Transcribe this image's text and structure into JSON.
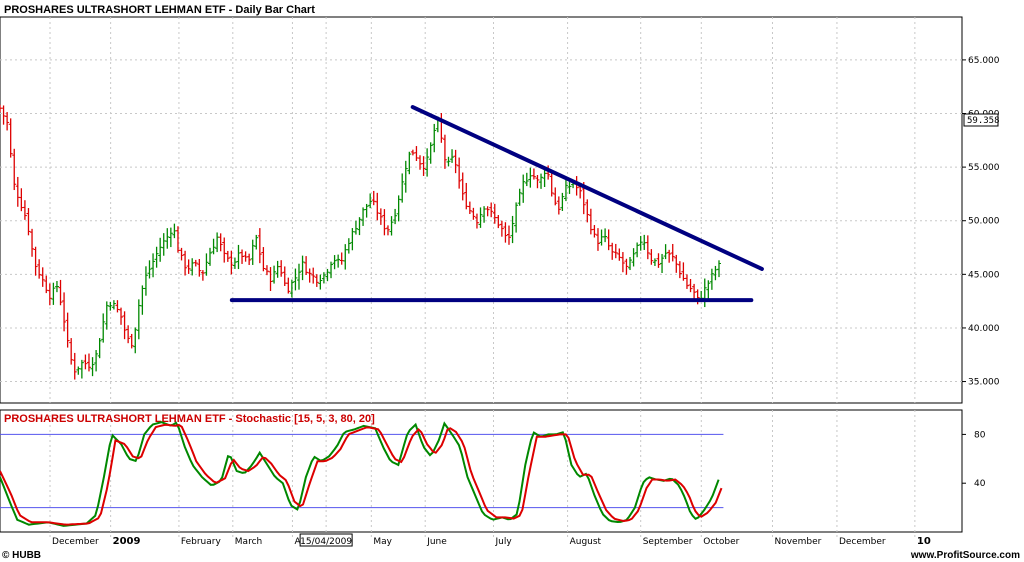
{
  "chart_data": [
    {
      "type": "ohlc",
      "title": "PROSHARES ULTRASHORT LEHMAN ETF - Daily Bar Chart",
      "ylim": [
        33,
        69
      ],
      "y_ticks": [
        "35.000",
        "40.000",
        "45.000",
        "50.000",
        "55.000",
        "60.000",
        "65.000"
      ],
      "last_value": "59.358",
      "colors": {
        "up": "#008800",
        "down": "#dd0000",
        "trendline": "#000080"
      },
      "trendlines": [
        {
          "name": "resistance",
          "points": [
            [
              0.429,
              60.6
            ],
            [
              0.792,
              45.5
            ]
          ]
        },
        {
          "name": "support",
          "points": [
            [
              0.241,
              42.6
            ],
            [
              0.781,
              42.6
            ]
          ]
        }
      ],
      "anchors": [
        [
          0.0,
          60.5
        ],
        [
          0.008,
          59.0
        ],
        [
          0.014,
          53.5
        ],
        [
          0.02,
          52.0
        ],
        [
          0.028,
          50.0
        ],
        [
          0.036,
          46.0
        ],
        [
          0.044,
          44.5
        ],
        [
          0.052,
          43.0
        ],
        [
          0.06,
          44.0
        ],
        [
          0.068,
          40.0
        ],
        [
          0.072,
          37.5
        ],
        [
          0.078,
          36.0
        ],
        [
          0.086,
          36.8
        ],
        [
          0.094,
          36.5
        ],
        [
          0.1,
          37.5
        ],
        [
          0.106,
          40.0
        ],
        [
          0.112,
          42.5
        ],
        [
          0.12,
          42.0
        ],
        [
          0.126,
          41.0
        ],
        [
          0.132,
          39.0
        ],
        [
          0.138,
          38.5
        ],
        [
          0.144,
          42.0
        ],
        [
          0.15,
          44.5
        ],
        [
          0.158,
          46.0
        ],
        [
          0.166,
          47.5
        ],
        [
          0.174,
          48.5
        ],
        [
          0.18,
          49.5
        ],
        [
          0.186,
          47.0
        ],
        [
          0.194,
          45.5
        ],
        [
          0.202,
          46.0
        ],
        [
          0.21,
          45.0
        ],
        [
          0.218,
          47.0
        ],
        [
          0.226,
          48.5
        ],
        [
          0.234,
          46.5
        ],
        [
          0.242,
          46.0
        ],
        [
          0.25,
          47.0
        ],
        [
          0.258,
          46.0
        ],
        [
          0.266,
          48.5
        ],
        [
          0.274,
          45.5
        ],
        [
          0.282,
          44.5
        ],
        [
          0.29,
          46.0
        ],
        [
          0.298,
          43.5
        ],
        [
          0.306,
          44.5
        ],
        [
          0.314,
          46.0
        ],
        [
          0.322,
          45.0
        ],
        [
          0.33,
          44.5
        ],
        [
          0.338,
          45.0
        ],
        [
          0.346,
          46.5
        ],
        [
          0.354,
          46.0
        ],
        [
          0.362,
          48.0
        ],
        [
          0.37,
          49.5
        ],
        [
          0.378,
          51.0
        ],
        [
          0.386,
          52.0
        ],
        [
          0.394,
          50.5
        ],
        [
          0.402,
          49.0
        ],
        [
          0.41,
          50.5
        ],
        [
          0.418,
          53.5
        ],
        [
          0.424,
          56.0
        ],
        [
          0.43,
          56.5
        ],
        [
          0.436,
          55.5
        ],
        [
          0.442,
          55.0
        ],
        [
          0.448,
          57.0
        ],
        [
          0.454,
          59.5
        ],
        [
          0.458,
          58.0
        ],
        [
          0.464,
          55.0
        ],
        [
          0.472,
          56.0
        ],
        [
          0.48,
          52.5
        ],
        [
          0.488,
          51.0
        ],
        [
          0.496,
          50.0
        ],
        [
          0.504,
          51.5
        ],
        [
          0.512,
          50.5
        ],
        [
          0.52,
          49.5
        ],
        [
          0.528,
          48.0
        ],
        [
          0.536,
          51.0
        ],
        [
          0.544,
          53.5
        ],
        [
          0.552,
          54.5
        ],
        [
          0.56,
          53.5
        ],
        [
          0.568,
          55.0
        ],
        [
          0.574,
          52.5
        ],
        [
          0.58,
          51.0
        ],
        [
          0.588,
          53.0
        ],
        [
          0.596,
          53.5
        ],
        [
          0.604,
          52.5
        ],
        [
          0.612,
          50.0
        ],
        [
          0.62,
          48.0
        ],
        [
          0.628,
          48.5
        ],
        [
          0.636,
          47.0
        ],
        [
          0.644,
          46.5
        ],
        [
          0.652,
          45.5
        ],
        [
          0.66,
          47.0
        ],
        [
          0.668,
          48.5
        ],
        [
          0.676,
          46.5
        ],
        [
          0.684,
          46.0
        ],
        [
          0.692,
          47.0
        ],
        [
          0.7,
          46.5
        ],
        [
          0.708,
          45.0
        ],
        [
          0.714,
          44.0
        ],
        [
          0.72,
          43.5
        ],
        [
          0.726,
          42.5
        ],
        [
          0.732,
          43.5
        ],
        [
          0.738,
          44.5
        ],
        [
          0.744,
          45.5
        ],
        [
          0.75,
          46.0
        ]
      ]
    },
    {
      "type": "line",
      "title": "PROSHARES ULTRASHORT LEHMAN ETF - Stochastic [15, 5, 3, 80, 20]",
      "ylim": [
        0,
        100
      ],
      "y_ticks": [
        "80",
        "40"
      ],
      "levels": [
        80,
        20
      ],
      "series": [
        {
          "color": "#008800",
          "anchors": [
            [
              0.0,
              45
            ],
            [
              0.01,
              25
            ],
            [
              0.018,
              10
            ],
            [
              0.03,
              6
            ],
            [
              0.05,
              8
            ],
            [
              0.066,
              5
            ],
            [
              0.09,
              7
            ],
            [
              0.1,
              14
            ],
            [
              0.108,
              45
            ],
            [
              0.116,
              80
            ],
            [
              0.126,
              72
            ],
            [
              0.134,
              60
            ],
            [
              0.142,
              58
            ],
            [
              0.15,
              80
            ],
            [
              0.158,
              88
            ],
            [
              0.168,
              90
            ],
            [
              0.178,
              87
            ],
            [
              0.184,
              90
            ],
            [
              0.192,
              70
            ],
            [
              0.2,
              55
            ],
            [
              0.21,
              45
            ],
            [
              0.22,
              38
            ],
            [
              0.23,
              42
            ],
            [
              0.238,
              65
            ],
            [
              0.246,
              50
            ],
            [
              0.254,
              48
            ],
            [
              0.262,
              55
            ],
            [
              0.27,
              65
            ],
            [
              0.278,
              55
            ],
            [
              0.286,
              45
            ],
            [
              0.294,
              40
            ],
            [
              0.302,
              22
            ],
            [
              0.31,
              18
            ],
            [
              0.318,
              45
            ],
            [
              0.326,
              62
            ],
            [
              0.334,
              58
            ],
            [
              0.342,
              62
            ],
            [
              0.35,
              70
            ],
            [
              0.358,
              82
            ],
            [
              0.368,
              84
            ],
            [
              0.378,
              87
            ],
            [
              0.39,
              85
            ],
            [
              0.398,
              70
            ],
            [
              0.406,
              58
            ],
            [
              0.414,
              55
            ],
            [
              0.424,
              82
            ],
            [
              0.432,
              88
            ],
            [
              0.44,
              70
            ],
            [
              0.448,
              62
            ],
            [
              0.456,
              75
            ],
            [
              0.462,
              89
            ],
            [
              0.47,
              80
            ],
            [
              0.478,
              70
            ],
            [
              0.486,
              45
            ],
            [
              0.494,
              30
            ],
            [
              0.502,
              15
            ],
            [
              0.512,
              10
            ],
            [
              0.522,
              12
            ],
            [
              0.53,
              10
            ],
            [
              0.538,
              15
            ],
            [
              0.546,
              55
            ],
            [
              0.554,
              82
            ],
            [
              0.562,
              78
            ],
            [
              0.57,
              80
            ],
            [
              0.578,
              80
            ],
            [
              0.586,
              82
            ],
            [
              0.594,
              55
            ],
            [
              0.602,
              45
            ],
            [
              0.61,
              48
            ],
            [
              0.618,
              30
            ],
            [
              0.626,
              15
            ],
            [
              0.634,
              9
            ],
            [
              0.644,
              8
            ],
            [
              0.652,
              10
            ],
            [
              0.66,
              20
            ],
            [
              0.668,
              40
            ],
            [
              0.674,
              45
            ],
            [
              0.682,
              43
            ],
            [
              0.69,
              42
            ],
            [
              0.698,
              44
            ],
            [
              0.706,
              38
            ],
            [
              0.712,
              28
            ],
            [
              0.718,
              15
            ],
            [
              0.724,
              10
            ],
            [
              0.732,
              18
            ],
            [
              0.74,
              28
            ],
            [
              0.748,
              45
            ]
          ]
        },
        {
          "color": "#dd0000",
          "anchors": [
            [
              0.0,
              50
            ],
            [
              0.012,
              30
            ],
            [
              0.02,
              14
            ],
            [
              0.032,
              8
            ],
            [
              0.05,
              8
            ],
            [
              0.068,
              6
            ],
            [
              0.092,
              7
            ],
            [
              0.104,
              12
            ],
            [
              0.112,
              38
            ],
            [
              0.12,
              75
            ],
            [
              0.13,
              72
            ],
            [
              0.138,
              62
            ],
            [
              0.146,
              60
            ],
            [
              0.154,
              76
            ],
            [
              0.162,
              86
            ],
            [
              0.172,
              88
            ],
            [
              0.182,
              87
            ],
            [
              0.188,
              88
            ],
            [
              0.196,
              74
            ],
            [
              0.204,
              58
            ],
            [
              0.214,
              47
            ],
            [
              0.224,
              40
            ],
            [
              0.234,
              44
            ],
            [
              0.242,
              60
            ],
            [
              0.25,
              52
            ],
            [
              0.258,
              50
            ],
            [
              0.266,
              54
            ],
            [
              0.274,
              62
            ],
            [
              0.282,
              56
            ],
            [
              0.29,
              47
            ],
            [
              0.298,
              42
            ],
            [
              0.306,
              25
            ],
            [
              0.314,
              20
            ],
            [
              0.322,
              40
            ],
            [
              0.33,
              58
            ],
            [
              0.338,
              58
            ],
            [
              0.346,
              61
            ],
            [
              0.354,
              68
            ],
            [
              0.362,
              80
            ],
            [
              0.372,
              83
            ],
            [
              0.382,
              86
            ],
            [
              0.394,
              84
            ],
            [
              0.402,
              72
            ],
            [
              0.41,
              60
            ],
            [
              0.418,
              57
            ],
            [
              0.428,
              78
            ],
            [
              0.436,
              85
            ],
            [
              0.444,
              72
            ],
            [
              0.452,
              64
            ],
            [
              0.46,
              72
            ],
            [
              0.466,
              86
            ],
            [
              0.474,
              82
            ],
            [
              0.482,
              72
            ],
            [
              0.49,
              48
            ],
            [
              0.498,
              33
            ],
            [
              0.506,
              18
            ],
            [
              0.516,
              12
            ],
            [
              0.526,
              12
            ],
            [
              0.534,
              11
            ],
            [
              0.542,
              14
            ],
            [
              0.55,
              48
            ],
            [
              0.558,
              78
            ],
            [
              0.566,
              78
            ],
            [
              0.574,
              79
            ],
            [
              0.582,
              80
            ],
            [
              0.59,
              80
            ],
            [
              0.598,
              58
            ],
            [
              0.606,
              47
            ],
            [
              0.614,
              47
            ],
            [
              0.622,
              32
            ],
            [
              0.63,
              18
            ],
            [
              0.638,
              11
            ],
            [
              0.648,
              9
            ],
            [
              0.656,
              10
            ],
            [
              0.664,
              18
            ],
            [
              0.672,
              36
            ],
            [
              0.678,
              43
            ],
            [
              0.686,
              43
            ],
            [
              0.694,
              42
            ],
            [
              0.702,
              43
            ],
            [
              0.71,
              38
            ],
            [
              0.716,
              30
            ],
            [
              0.722,
              18
            ],
            [
              0.728,
              12
            ],
            [
              0.736,
              16
            ],
            [
              0.744,
              24
            ],
            [
              0.75,
              36
            ]
          ]
        }
      ]
    }
  ],
  "x_axis": {
    "labels": [
      {
        "text": "December",
        "pos": 0.052
      },
      {
        "text": "2009",
        "pos": 0.115,
        "bold": true
      },
      {
        "text": "February",
        "pos": 0.186
      },
      {
        "text": "March",
        "pos": 0.242
      },
      {
        "text": "A",
        "pos": 0.304
      },
      {
        "text": "15/04/2009",
        "pos": 0.339,
        "boxed": true
      },
      {
        "text": "May",
        "pos": 0.386
      },
      {
        "text": "June",
        "pos": 0.442
      },
      {
        "text": "July",
        "pos": 0.513
      },
      {
        "text": "August",
        "pos": 0.59
      },
      {
        "text": "September",
        "pos": 0.666
      },
      {
        "text": "October",
        "pos": 0.729
      },
      {
        "text": "November",
        "pos": 0.803
      },
      {
        "text": "December",
        "pos": 0.87
      },
      {
        "text": "10",
        "pos": 0.951,
        "bold": true
      }
    ]
  },
  "footer": {
    "left": "© HUBB",
    "right": "www.ProfitSource.com"
  }
}
